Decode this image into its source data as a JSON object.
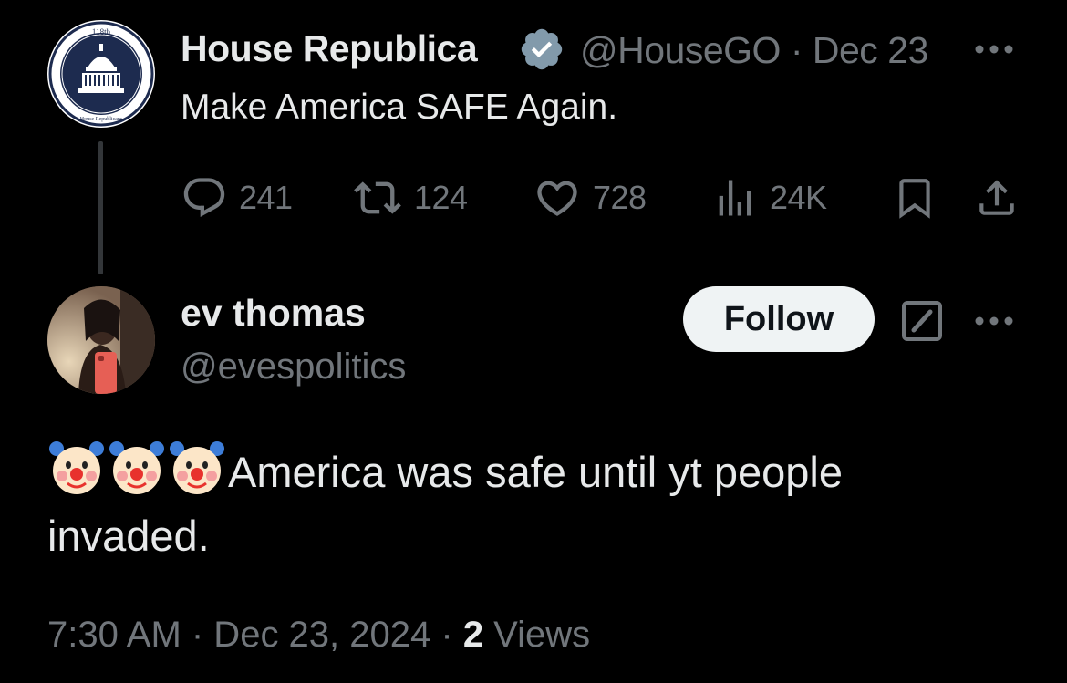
{
  "parent_tweet": {
    "author_name": "House Republica",
    "handle": "@HouseGO",
    "date": "Dec 23",
    "separator": "·",
    "text": "Make America SAFE Again.",
    "logo_text_top": "118th",
    "logo_text_bottom": "House Republicans",
    "stats": {
      "replies": "241",
      "reposts": "124",
      "likes": "728",
      "views": "24K"
    }
  },
  "reply": {
    "author_name": "ev thomas",
    "handle": "@evespolitics",
    "follow_label": "Follow",
    "emojis": [
      "clown-face",
      "clown-face",
      "clown-face"
    ],
    "text": "America was safe until yt people invaded.",
    "timestamp": "7:30 AM · Dec 23, 2024 · ",
    "views_count": "2",
    "views_label": " Views"
  },
  "colors": {
    "background": "#000000",
    "text_primary": "#e7e9ea",
    "text_secondary": "#71767b",
    "verified_badge": "#829aab"
  }
}
